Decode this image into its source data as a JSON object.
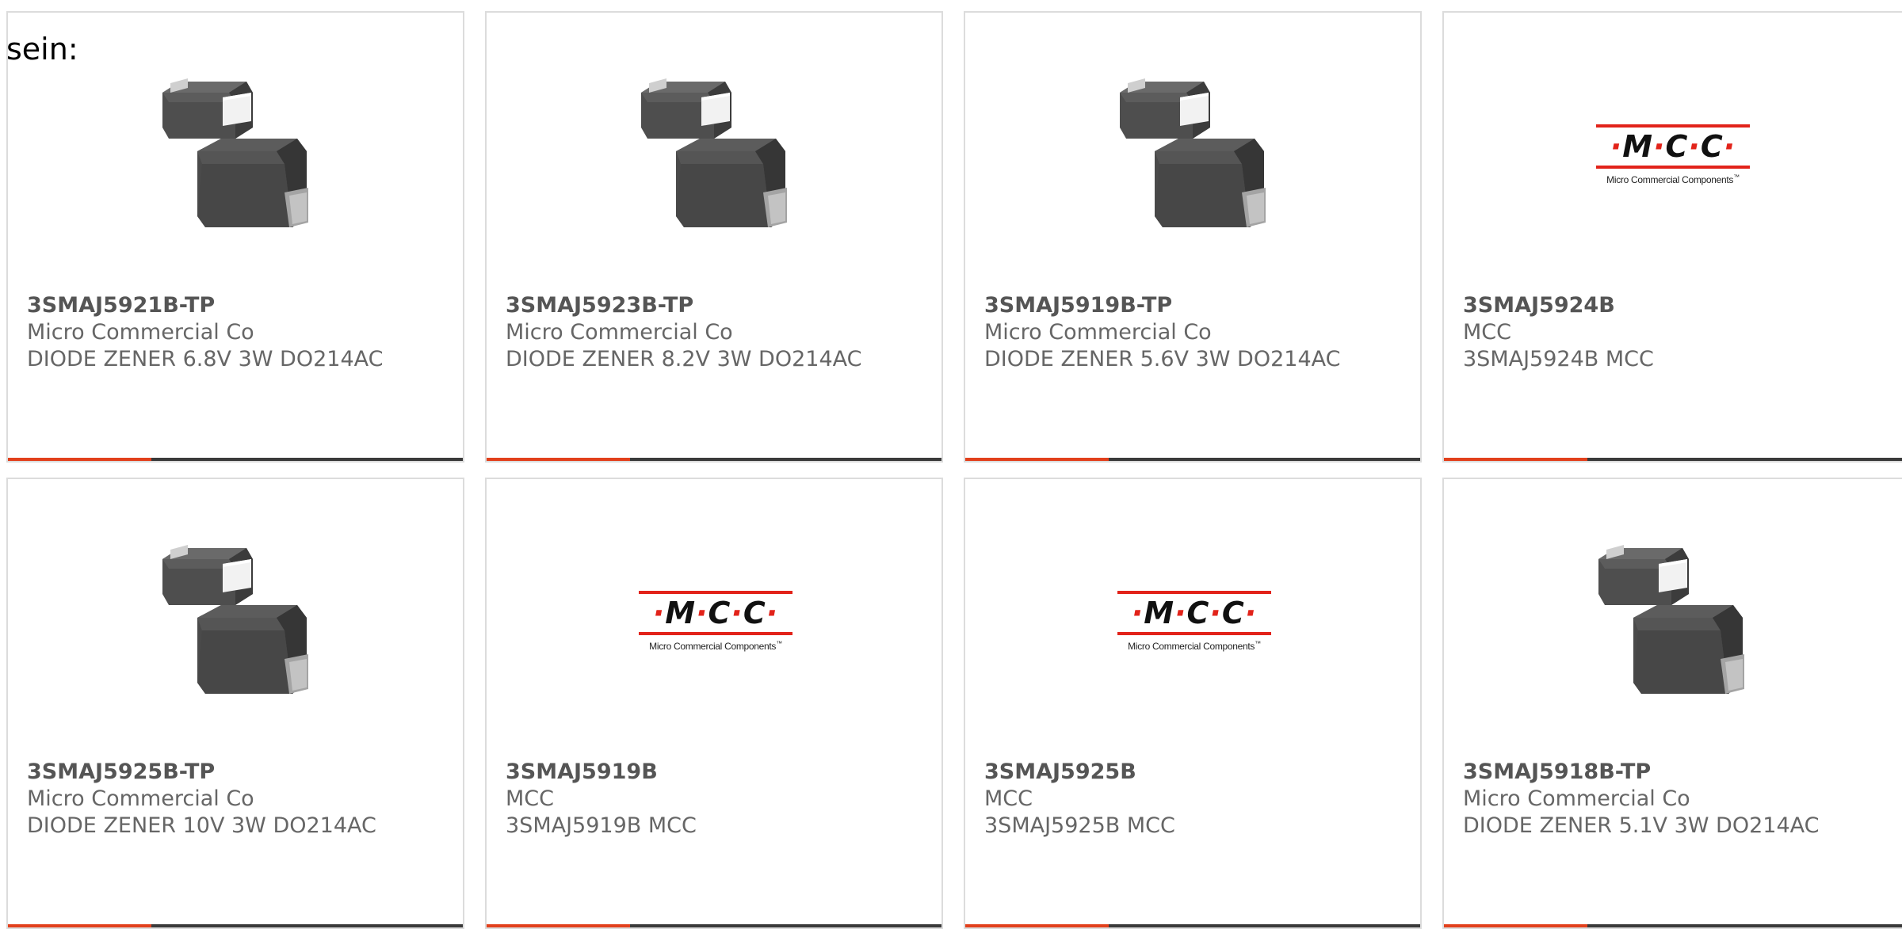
{
  "intro_text": "sein:",
  "colors": {
    "accent": "#e2401c",
    "bar_dark": "#3a3a3a",
    "border": "#dcdcdc",
    "mcc_red": "#e2231a"
  },
  "logo": {
    "mark_letters": [
      "M",
      "C",
      "C"
    ],
    "dot": "·",
    "subtitle": "Micro Commercial Components",
    "tm": "™"
  },
  "cards": [
    {
      "part": "3SMAJ5921B-TP",
      "maker": "Micro Commercial Co",
      "desc": "DIODE ZENER 6.8V 3W DO214AC",
      "image": "diode-package-image"
    },
    {
      "part": "3SMAJ5923B-TP",
      "maker": "Micro Commercial Co",
      "desc": "DIODE ZENER 8.2V 3W DO214AC",
      "image": "diode-package-image"
    },
    {
      "part": "3SMAJ5919B-TP",
      "maker": "Micro Commercial Co",
      "desc": "DIODE ZENER 5.6V 3W DO214AC",
      "image": "diode-package-image"
    },
    {
      "part": "3SMAJ5924B",
      "maker": "MCC",
      "desc": "3SMAJ5924B MCC",
      "image": "mcc-logo"
    },
    {
      "part": "3SMAJ5925B-TP",
      "maker": "Micro Commercial Co",
      "desc": "DIODE ZENER 10V 3W DO214AC",
      "image": "diode-package-image"
    },
    {
      "part": "3SMAJ5919B",
      "maker": "MCC",
      "desc": "3SMAJ5919B MCC",
      "image": "mcc-logo"
    },
    {
      "part": "3SMAJ5925B",
      "maker": "MCC",
      "desc": "3SMAJ5925B MCC",
      "image": "mcc-logo"
    },
    {
      "part": "3SMAJ5918B-TP",
      "maker": "Micro Commercial Co",
      "desc": "DIODE ZENER 5.1V 3W DO214AC",
      "image": "diode-package-image"
    }
  ]
}
